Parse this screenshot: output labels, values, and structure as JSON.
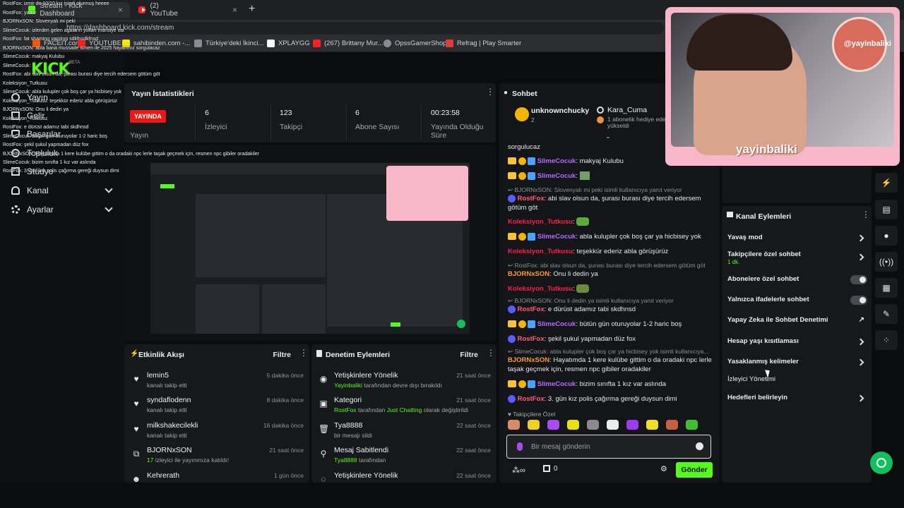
{
  "browser": {
    "tabs": [
      {
        "label": "Stream - Kick Dashboard",
        "active": true
      },
      {
        "label": "(2) YouTube",
        "active": false
      }
    ],
    "url": "https://dashboard.kick.com/stream",
    "bookmarks": [
      "FACEIT.com",
      "YOUTUBE",
      "sahibinden.com -...",
      "Türkiye'deki İkinci...",
      "XPLAYGG",
      "(267) Brittany Mur...",
      "OpssGamerShop",
      "Refrag | Play Smarter"
    ]
  },
  "sidebar": {
    "logo": "KICK",
    "beta": "BETA",
    "items": [
      {
        "label": "Yayın"
      },
      {
        "label": "Gelir"
      },
      {
        "label": "Başarılar"
      },
      {
        "label": "Topluluk"
      },
      {
        "label": "Stüdyo"
      },
      {
        "label": "Kanal"
      },
      {
        "label": "Ayarlar"
      }
    ]
  },
  "stats": {
    "title": "Yayın İstatistikleri",
    "live_badge": "YAYINDA",
    "live_label": "Yayın",
    "items": [
      {
        "value": "6",
        "label": "İzleyici"
      },
      {
        "value": "123",
        "label": "Takipçi"
      },
      {
        "value": "6",
        "label": "Abone Sayısı"
      },
      {
        "value": "00:23:58",
        "label": "Yayında Olduğu Süre"
      }
    ]
  },
  "activity": {
    "title": "Etkinlik Akışı",
    "filter": "Filtre",
    "items": [
      {
        "icon": "heart-icon",
        "name": "lemin5",
        "sub": "kanalı takip etti",
        "time": "5 dakika önce"
      },
      {
        "icon": "heart-icon",
        "name": "syndaflodenn",
        "sub": "kanalı takip etti",
        "time": "8 dakika önce"
      },
      {
        "icon": "heart-icon",
        "name": "milkshakecilekli",
        "sub": "kanalı takip etti",
        "time": "16 dakika önce"
      },
      {
        "icon": "host-icon",
        "name": "BJORNxSON",
        "sub_prefix": "17",
        "sub": "izleyici ile yayınınıza katıldı!",
        "time": "21 saat önce"
      },
      {
        "icon": "person-icon",
        "name": "Kehrerath",
        "sub": "",
        "time": "1 gün önce"
      }
    ]
  },
  "modlog": {
    "title": "Denetim Eylemleri",
    "filter": "Filtre",
    "items": [
      {
        "icon": "eye-icon",
        "name": "Yetişkinlere Yönelik",
        "sub_user": "Yayinbaliki",
        "sub": "tarafından devre dışı bırakıldı",
        "time": "21 saat önce"
      },
      {
        "icon": "category-icon",
        "name": "Kategori",
        "sub_user": "RostFox",
        "sub_mid": "tarafından",
        "sub_cat": "Just Chatting",
        "sub": "olarak değiştirildi",
        "time": "21 saat önce"
      },
      {
        "icon": "trash-icon",
        "name": "Tya8888",
        "sub": "bir mesajı sildi",
        "time": "22 saat önce"
      },
      {
        "icon": "pin-icon",
        "name": "Mesaj Sabitlendi",
        "sub_user": "Tya8888",
        "sub": "tarafından",
        "time": "22 saat önce"
      },
      {
        "icon": "eye-off-icon",
        "name": "Yetişkinlere Yönelik",
        "sub": "",
        "time": "22 saat önce"
      }
    ]
  },
  "chat": {
    "title": "Sohbet",
    "top_gifter": {
      "name": "unknownchucky",
      "count": "2"
    },
    "top_gift": {
      "name": "Kara_Cuma",
      "text": "1 abonelik hediye ederek yükseldi"
    },
    "first_line": "sorgulucaz",
    "messages": [
      {
        "type": "msg",
        "user": "SlimeCocuk",
        "color": "slime",
        "badges": true,
        "text": ": makyaj Kulubu"
      },
      {
        "type": "msg",
        "user": "SlimeCocuk",
        "color": "slime",
        "badges": true,
        "text": ":"
      },
      {
        "type": "reply",
        "text": "BJORNxSON: Slovenyalı mi peki isimli kullanıcıya yanıt veriyor"
      },
      {
        "type": "msg",
        "user": "RostFox",
        "color": "rost",
        "text": ": abi slav olsun da, şurası burası diye tercih edersem götüm göt"
      },
      {
        "type": "msg",
        "user": "Koleksiyon_Tutkusu",
        "color": "kole",
        "text": ":"
      },
      {
        "type": "msg",
        "user": "SlimeCocuk",
        "color": "slime",
        "badges": true,
        "text": ": abla kulupler çok boş çar ya hicbisey yok"
      },
      {
        "type": "msg",
        "user": "Koleksiyon_Tutkusu",
        "color": "kole",
        "text": ": teşekkür ederiz abla görüşürüz"
      },
      {
        "type": "reply",
        "text": "RostFox: abi slav olsun da, şurası burası diye tercih edersem götüm göt"
      },
      {
        "type": "msg",
        "user": "BJORNxSON",
        "color": "bjorn",
        "text": ": Onu li dedin ya"
      },
      {
        "type": "msg",
        "user": "Koleksiyon_Tutkusu",
        "color": "kole",
        "text": ":"
      },
      {
        "type": "reply",
        "text": "BJORNxSON: Onu li dedin ya isimli kullanıcıya yanıt veriyor"
      },
      {
        "type": "msg",
        "user": "RostFox",
        "color": "rost",
        "text": ": e dürüst adamız tabi skdhnsd"
      },
      {
        "type": "msg",
        "user": "SlimeCocuk",
        "color": "slime",
        "badges": true,
        "text": ": bütün gün oturuyolar 1-2 haric boş"
      },
      {
        "type": "msg",
        "user": "RostFox",
        "color": "rost",
        "text": ": şekil şukul yapmadan düz fox"
      },
      {
        "type": "reply",
        "text": "SlimeCocuk: abla kulupler çok boş çar ya hicbisey yok isimli kullanıcıya..."
      },
      {
        "type": "msg",
        "user": "BJORNxSON",
        "color": "bjorn",
        "text": ": Hayatımda 1 kere kulübe gittim o da oradaki npc lerle taşak geçmek için, resmen npc gibiler oradakiler"
      },
      {
        "type": "msg",
        "user": "SlimeCocuk",
        "color": "slime",
        "badges": true,
        "text": ": bizim sınıfta 1 kız var aslında"
      },
      {
        "type": "msg",
        "user": "RostFox",
        "color": "rost",
        "text": ": 3. gün kız polis çağırma gereği duysun dimi"
      }
    ],
    "followers_only": "Takipçilere Özel",
    "placeholder": "Bir mesaj gönderin",
    "points": "0",
    "send": "Gönder"
  },
  "channel_actions": {
    "title": "Kanal Eylemleri",
    "items": [
      {
        "label": "Yavaş mod",
        "kind": "chevron"
      },
      {
        "label": "Takipçilere özel sohbet",
        "sub": "1 dk.",
        "kind": "chevron"
      },
      {
        "label": "Abonelere özel sohbet",
        "kind": "toggle"
      },
      {
        "label": "Yalnızca ifadelerle sohbet",
        "kind": "toggle"
      },
      {
        "label": "Yapay Zeka ile Sohbet Denetimi",
        "kind": "external"
      },
      {
        "label": "Hesap yaşı kısıtlaması",
        "kind": "chevron"
      },
      {
        "label": "Yasaklanmış kelimeler",
        "kind": "chevron"
      },
      {
        "label": "İzleyici Yönetimi",
        "kind": "none"
      },
      {
        "label": "Hedefleri belirleyin",
        "kind": "chevron"
      }
    ]
  },
  "webcam": {
    "name": "yayinbaliki",
    "logo_text": "@yayinbaliki"
  },
  "overlay_chat": [
    "RostFox: izmir de 10/10 kız isimli olurmuş heeee",
    "RostFox: yaaar",
    "BJORNxSON: Slovenyalı mi peki",
    "SlimeCocuk: izlerden gelen agaların yolları mansiye var",
    "RostFox: fat shaming yapılıyo sdkfnsdkfnsd",
    "BJORNxSON: abla bana mussade ismen ile 2025 hayatımız sorgulacaz",
    "SlimeCocuk: makyaj Kulubu",
    "SlimeCocuk:",
    "RostFox: abi slav olsun da, şurası burası diye tercih edersem götüm göt",
    "Koleksiyon_Tutkusu:",
    "SlimeCocuk: abla kulupler çok boş çar ya hicbisey yok",
    "Koleksiyon_Tutkusu: teşekkür ederiz abla görüşürüz",
    "BJORNxSON: Onu li dedin ya",
    "Koleksiyon_Tutkusu:",
    "RostFox: e dürüst adamız tabi skdhnsd",
    "SlimeCocuk: bütün gün oturuyolar 1-2 haric boş",
    "RostFox: şekil şukul yapmadan düz fox",
    "BJORNxSON: Hayatımda 1 kere kulübe gittim o da oradaki npc lerle taşak geçmek için, resmen npc gibiler oradakiler",
    "SlimeCocuk: bizim sınıfta 1 kız var aslında",
    "RostFox: 3. gün kız polis çağırma gereği duysun dimi"
  ],
  "colors": {
    "kick_green": "#53fc18",
    "live_red": "#e91916",
    "panel_bg": "#17181b",
    "page_bg": "#0b0c0e"
  }
}
